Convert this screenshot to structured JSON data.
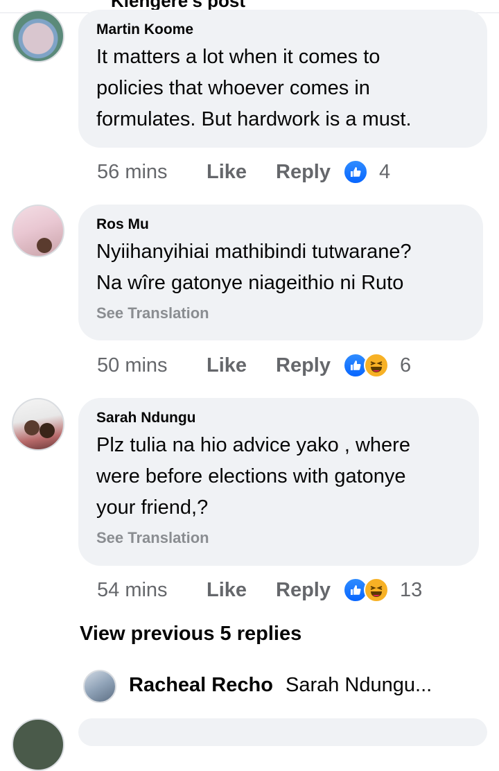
{
  "header": {
    "title": "Kiengere's post"
  },
  "comments": [
    {
      "author": "Martin Koome",
      "text": [
        "It matters a lot when it comes to",
        "policies that whoever comes in",
        "formulates. But hardwork is a must."
      ],
      "see_translation": "",
      "time": "56 mins",
      "like_label": "Like",
      "reply_label": "Reply",
      "reactions": [
        "like-icon"
      ],
      "reaction_count": "4"
    },
    {
      "author": "Ros Mu",
      "text": [
        "Nyiihanyihiai mathibindi tutwarane?",
        "Na wîre gatonye niageithio ni Ruto"
      ],
      "see_translation": "See Translation",
      "time": "50 mins",
      "like_label": "Like",
      "reply_label": "Reply",
      "reactions": [
        "like-icon",
        "haha-icon"
      ],
      "reaction_count": "6"
    },
    {
      "author": "Sarah Ndungu",
      "text": [
        "Plz tulia na hio advice yako , where",
        "were before elections with gatonye",
        "your friend,?"
      ],
      "see_translation": "See Translation",
      "time": "54 mins",
      "like_label": "Like",
      "reply_label": "Reply",
      "reactions": [
        "like-icon",
        "haha-icon"
      ],
      "reaction_count": "13"
    }
  ],
  "view_previous": "View previous 5 replies",
  "reply_preview": {
    "author": "Racheal Recho",
    "text": "Sarah Ndungu..."
  },
  "colors": {
    "bubble": "#f0f2f5",
    "muted": "#65676b",
    "like_blue": "#0866ff",
    "haha_yellow": "#f7b125"
  }
}
